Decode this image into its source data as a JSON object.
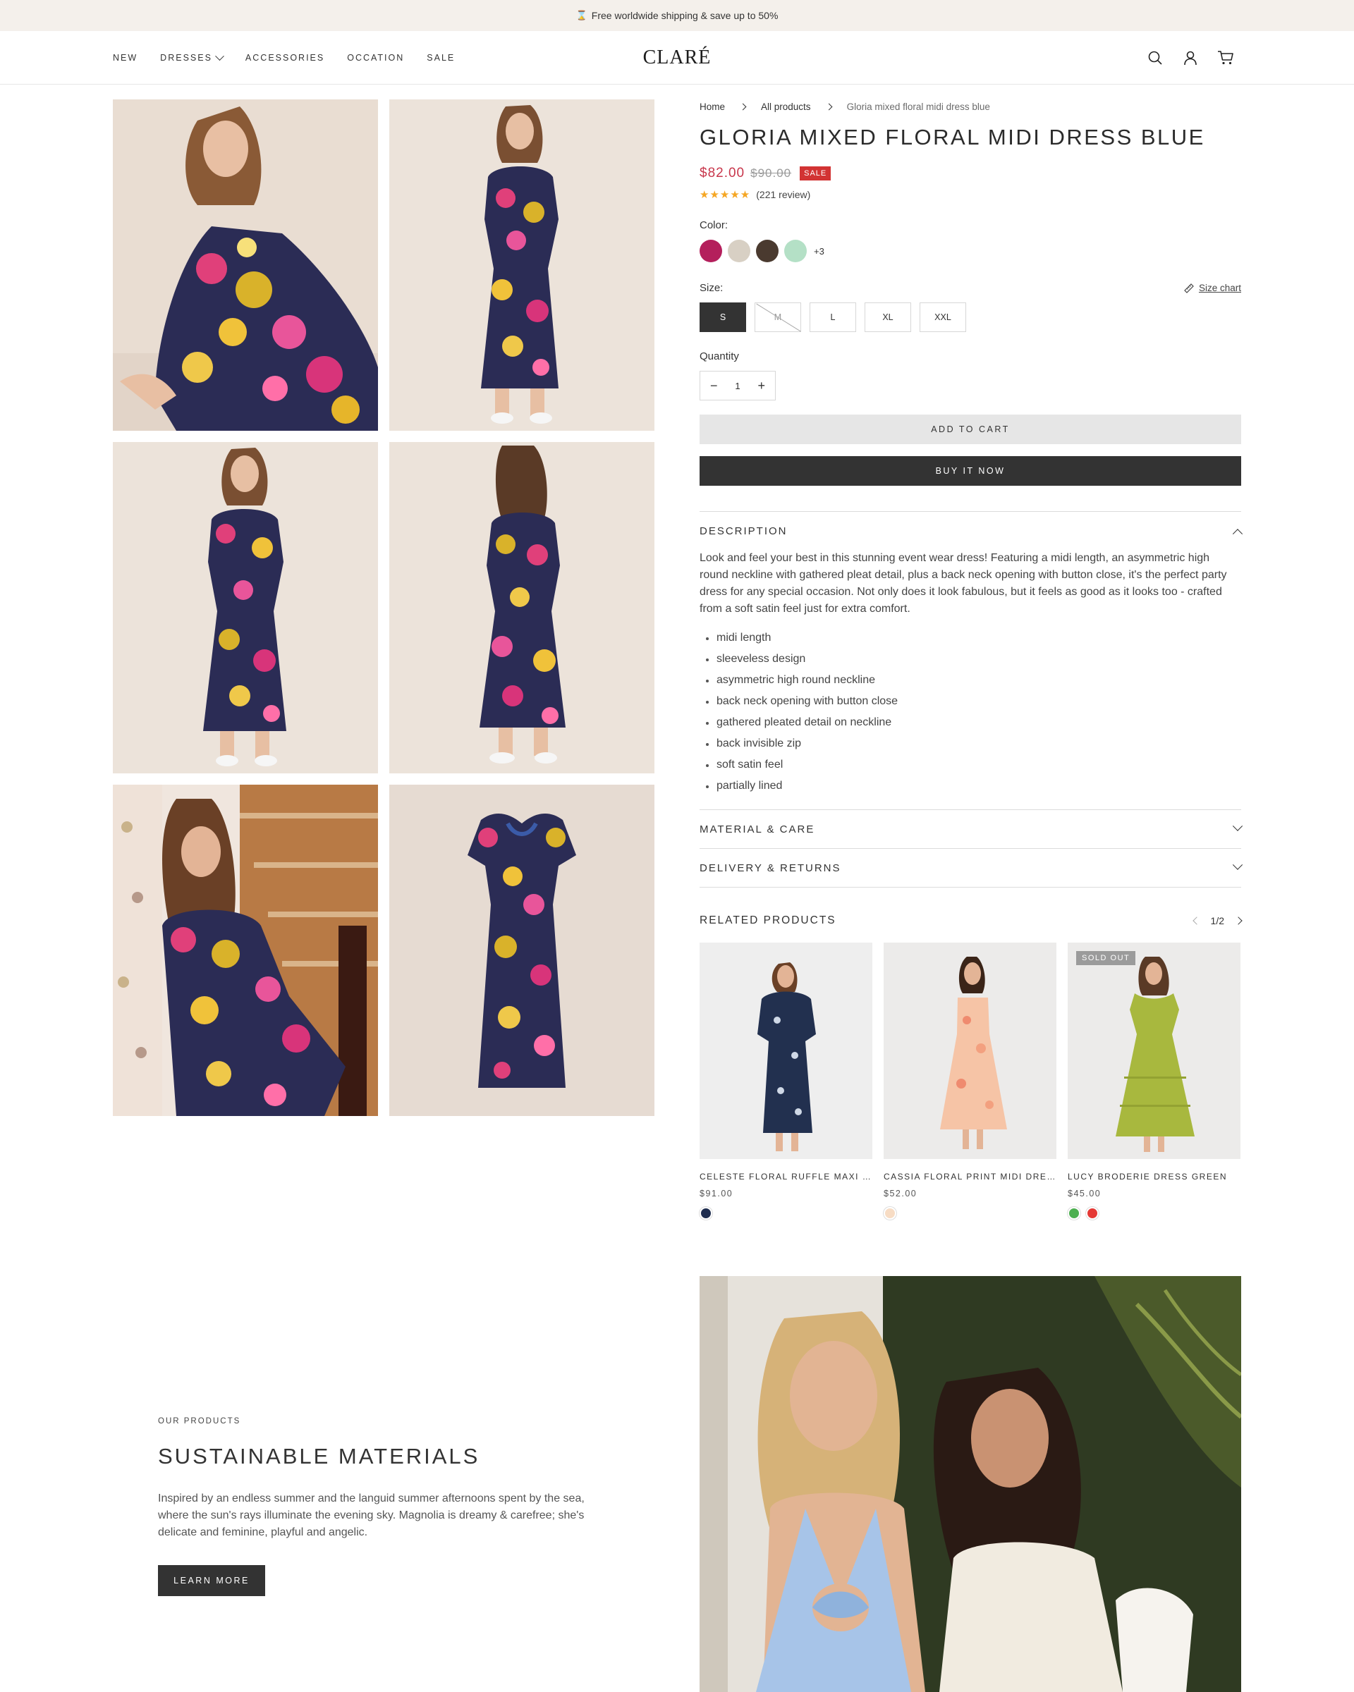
{
  "announcement": {
    "icon": "hourglass-icon",
    "text": "Free worldwide shipping & save up to 50%"
  },
  "nav": {
    "items": [
      {
        "label": "NEW"
      },
      {
        "label": "DRESSES"
      },
      {
        "label": "ACCESSORIES"
      },
      {
        "label": "OCCATION"
      },
      {
        "label": "SALE"
      }
    ]
  },
  "logo": "CLARÉ",
  "header_icons": [
    "search-icon",
    "account-icon",
    "cart-icon"
  ],
  "gallery": {
    "image_count": 6
  },
  "breadcrumb": {
    "home": "Home",
    "all": "All products",
    "current": "Gloria mixed floral midi dress blue"
  },
  "product": {
    "title": "GLORIA MIXED FLORAL MIDI DRESS BLUE",
    "price": "$82.00",
    "old_price": "$90.00",
    "badge": "SALE",
    "rating_count": "(221 review)",
    "stars": 5,
    "color_label": "Color:",
    "colors": [
      "#b41f5c",
      "#d8d0c4",
      "#4a3a2f",
      "#b4e0c6"
    ],
    "more_colors": "+3",
    "size_label": "Size:",
    "size_chart": "Size chart",
    "sizes": [
      "S",
      "M",
      "L",
      "XL",
      "XXL"
    ],
    "selected_size": "S",
    "unavailable_size": "M",
    "quantity_label": "Quantity",
    "quantity": "1",
    "add_to_cart": "ADD TO CART",
    "buy_now": "BUY IT NOW"
  },
  "description": {
    "title": "DESCRIPTION",
    "text": "Look and feel your best in this stunning event wear dress! Featuring a midi length, an asymmetric high round neckline with gathered pleat detail, plus a back neck opening with button close, it's the perfect party dress for any special occasion. Not only does it look fabulous, but it feels as good as it looks too - crafted from a soft satin feel just for extra comfort.",
    "bullets": [
      "midi length",
      "sleeveless design",
      "asymmetric high round neckline",
      "back neck opening with button close",
      "gathered pleated detail on neckline",
      "back invisible zip",
      "soft satin feel",
      "partially lined"
    ]
  },
  "material": {
    "title": "MATERIAL & CARE"
  },
  "delivery": {
    "title": "DELIVERY & RETURNS"
  },
  "related": {
    "title": "RELATED PRODUCTS",
    "page": "1/2",
    "products": [
      {
        "name": "CELESTE FLORAL RUFFLE MAXI DRESS NAVY",
        "price": "$91.00",
        "colors": [
          "#1f2d4f"
        ],
        "sold_out": ""
      },
      {
        "name": "CASSIA FLORAL PRINT MIDI DRESS NUDE",
        "price": "$52.00",
        "colors": [
          "#f7dcc4"
        ],
        "sold_out": ""
      },
      {
        "name": "LUCY BRODERIE DRESS GREEN",
        "price": "$45.00",
        "colors": [
          "#4caf50",
          "#e53935"
        ],
        "sold_out": "SOLD OUT"
      }
    ]
  },
  "sustainable": {
    "eyebrow": "OUR PRODUCTS",
    "title": "SUSTAINABLE MATERIALS",
    "text": "Inspired by an endless summer and the languid summer afternoons spent by the sea, where the sun's rays illuminate the evening sky. Magnolia is dreamy & carefree; she's delicate and feminine, playful and angelic.",
    "button": "LEARN MORE"
  }
}
